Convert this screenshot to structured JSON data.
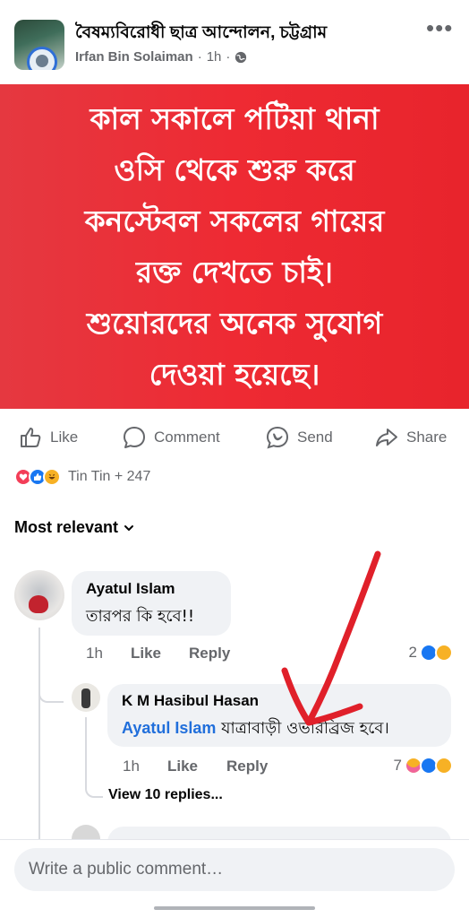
{
  "header": {
    "group_name": "বৈষম্যবিরোধী ছাত্র আন্দোলন, চট্টগ্রাম",
    "author": "Irfan Bin Solaiman",
    "time": "1h",
    "separator": "·",
    "privacy_icon": "globe-icon",
    "more_icon": "more-icon"
  },
  "post": {
    "banner_text": "কাল সকালে পটিয়া থানা\nওসি থেকে শুরু করে\nকনস্টেবল সকলের গায়ের\nরক্ত দেখতে চাই।\nশুয়োরদের অনেক সুযোগ\nদেওয়া হয়েছে।",
    "banner_color": "#ec2a32"
  },
  "actions": {
    "like": "Like",
    "comment": "Comment",
    "send": "Send",
    "share": "Share"
  },
  "reactions": {
    "icons": [
      "love",
      "like",
      "haha"
    ],
    "summary": "Tin Tin + 247"
  },
  "sort": {
    "label": "Most relevant"
  },
  "comments": [
    {
      "author": "Ayatul Islam",
      "text": "তারপর কি হবে!!",
      "time": "1h",
      "like": "Like",
      "reply": "Reply",
      "reaction_count": "2",
      "reaction_icons": [
        "like",
        "haha"
      ],
      "replies": [
        {
          "author": "K M Hasibul Hasan",
          "mention": "Ayatul Islam",
          "text": "যাত্রাবাড়ী ওভারব্রিজ হবে।",
          "time": "1h",
          "like": "Like",
          "reply": "Reply",
          "reaction_count": "7",
          "reaction_icons": [
            "care",
            "like",
            "haha"
          ]
        }
      ],
      "view_replies": "View 10 replies..."
    }
  ],
  "composer": {
    "placeholder": "Write a public comment…"
  },
  "colors": {
    "accent": "#1877f2",
    "mention": "#216fdb",
    "annotation_arrow": "#e0202a"
  }
}
